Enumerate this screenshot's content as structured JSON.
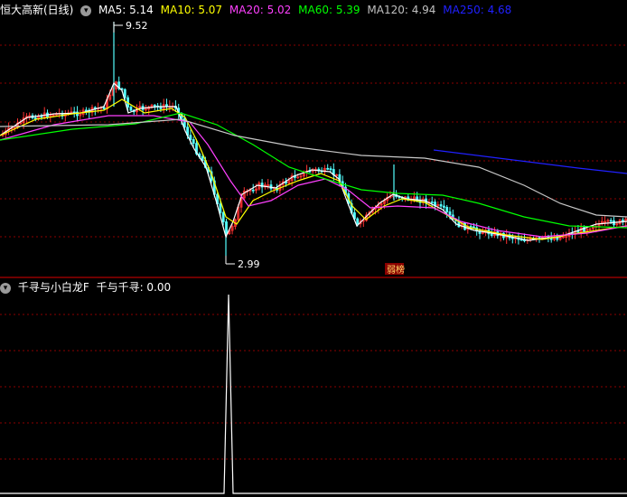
{
  "main_panel": {
    "stock_title": "恒大高新(日线)",
    "indicators": [
      {
        "label": "MA5: 5.14",
        "color": "#ffffff"
      },
      {
        "label": "MA10: 5.07",
        "color": "#ffff00"
      },
      {
        "label": "MA20: 5.02",
        "color": "#ff40ff"
      },
      {
        "label": "MA60: 5.39",
        "color": "#00ff00"
      },
      {
        "label": "MA120: 4.94",
        "color": "#c0c0c0"
      },
      {
        "label": "MA250: 4.68",
        "color": "#2020ff"
      }
    ],
    "high_marker": "9.52",
    "low_marker": "2.99",
    "badge": "弱榜"
  },
  "sub_panel": {
    "title": "千寻与小白龙F",
    "value_label": "千与千寻: 0.00"
  },
  "colors": {
    "up": "#ff3232",
    "down": "#54ffff",
    "grid": "#8b0000",
    "divider": "#b00000"
  }
}
